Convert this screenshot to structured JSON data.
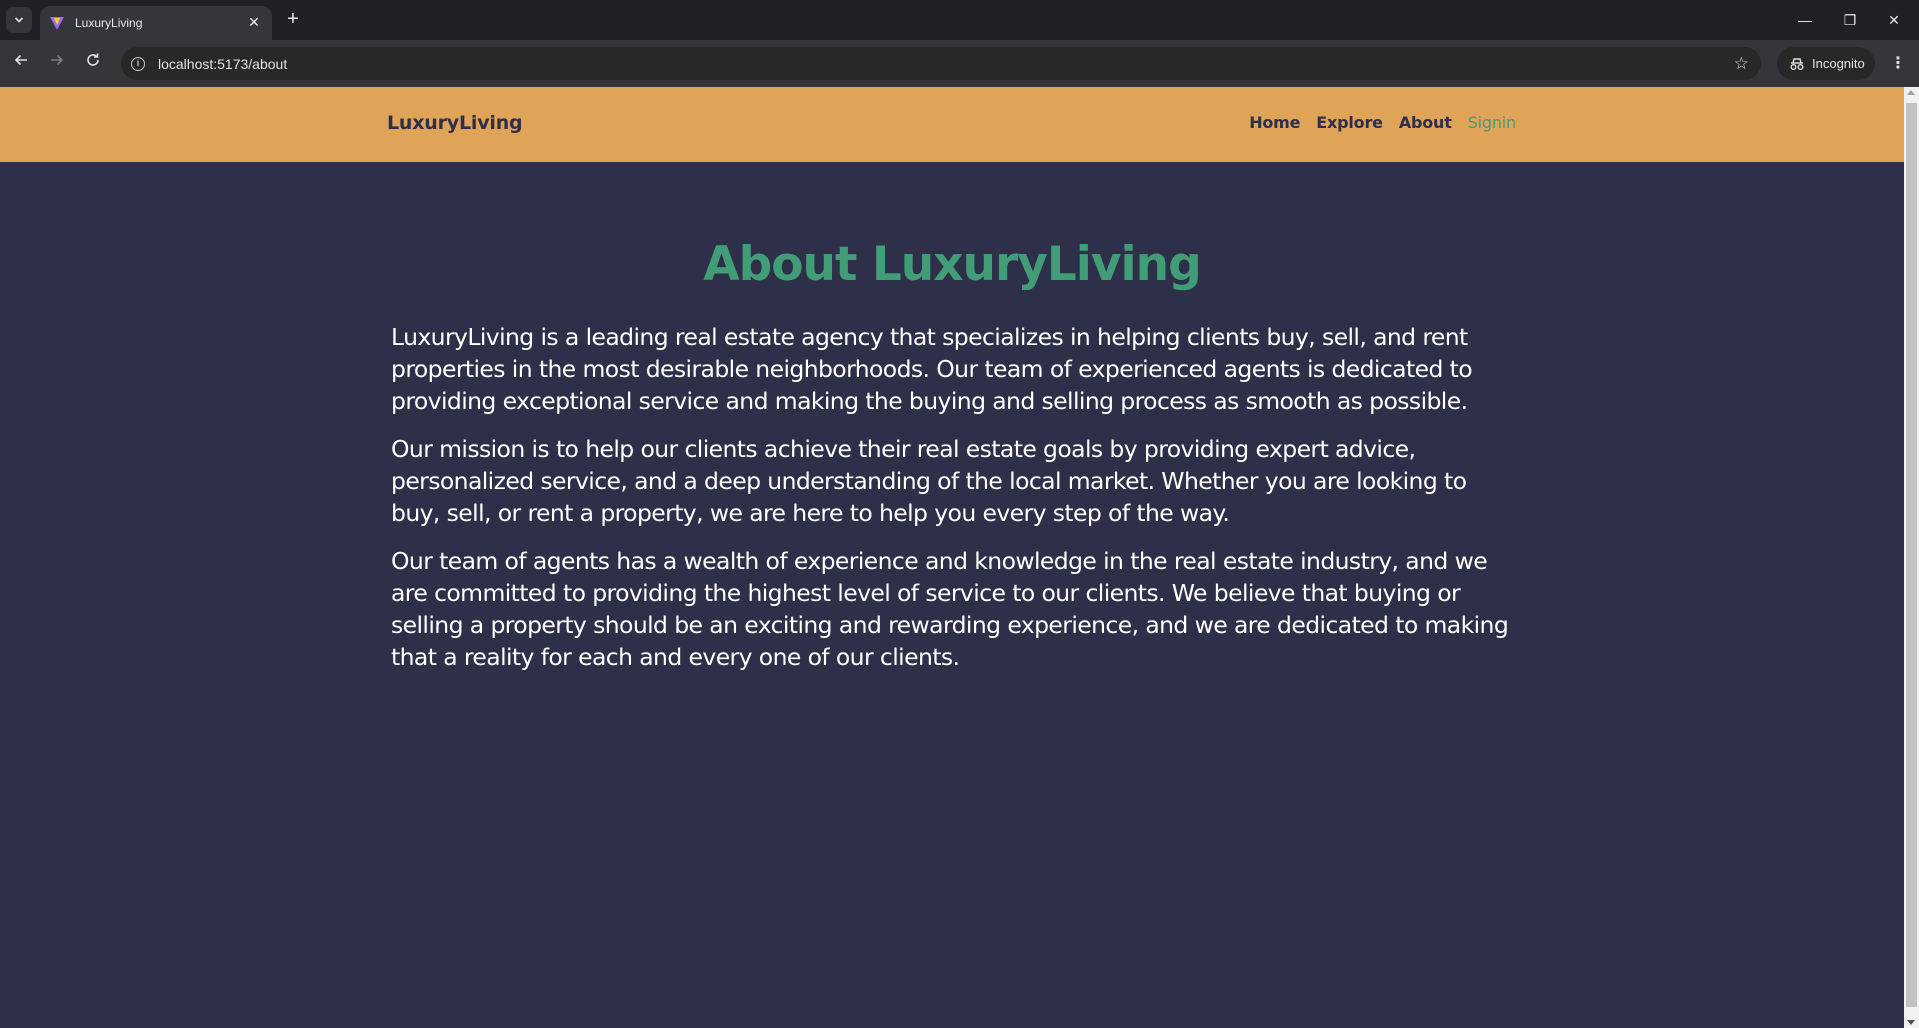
{
  "browser": {
    "tab_title": "LuxuryLiving",
    "tab_close": "✕",
    "new_tab": "+",
    "url": "localhost:5173/about",
    "incognito_label": "Incognito",
    "window_controls": {
      "minimize": "—",
      "restore": "❐",
      "close": "✕"
    },
    "icons": {
      "tab_search": "chevron-down-icon",
      "back": "arrow-left-icon",
      "forward": "arrow-right-icon",
      "reload": "reload-icon",
      "site_info": "info-icon",
      "bookmark": "star-icon",
      "incognito": "incognito-icon",
      "menu": "kebab-menu-icon"
    }
  },
  "header": {
    "brand": "LuxuryLiving",
    "nav": [
      {
        "label": "Home"
      },
      {
        "label": "Explore"
      },
      {
        "label": "About"
      },
      {
        "label": "Signin"
      }
    ]
  },
  "main": {
    "title": "About LuxuryLiving",
    "paragraphs": [
      "LuxuryLiving is a leading real estate agency that specializes in helping clients buy, sell, and rent properties in the most desirable neighborhoods. Our team of experienced agents is dedicated to providing exceptional service and making the buying and selling process as smooth as possible.",
      "Our mission is to help our clients achieve their real estate goals by providing expert advice, personalized service, and a deep understanding of the local market. Whether you are looking to buy, sell, or rent a property, we are here to help you every step of the way.",
      "Our team of agents has a wealth of experience and knowledge in the real estate industry, and we are committed to providing the highest level of service to our clients. We believe that buying or selling a property should be an exciting and rewarding experience, and we are dedicated to making that a reality for each and every one of our clients."
    ]
  },
  "colors": {
    "header_bg": "#e0a458",
    "page_bg": "#2e2f48",
    "accent": "#419d78",
    "text": "#ffffff"
  }
}
